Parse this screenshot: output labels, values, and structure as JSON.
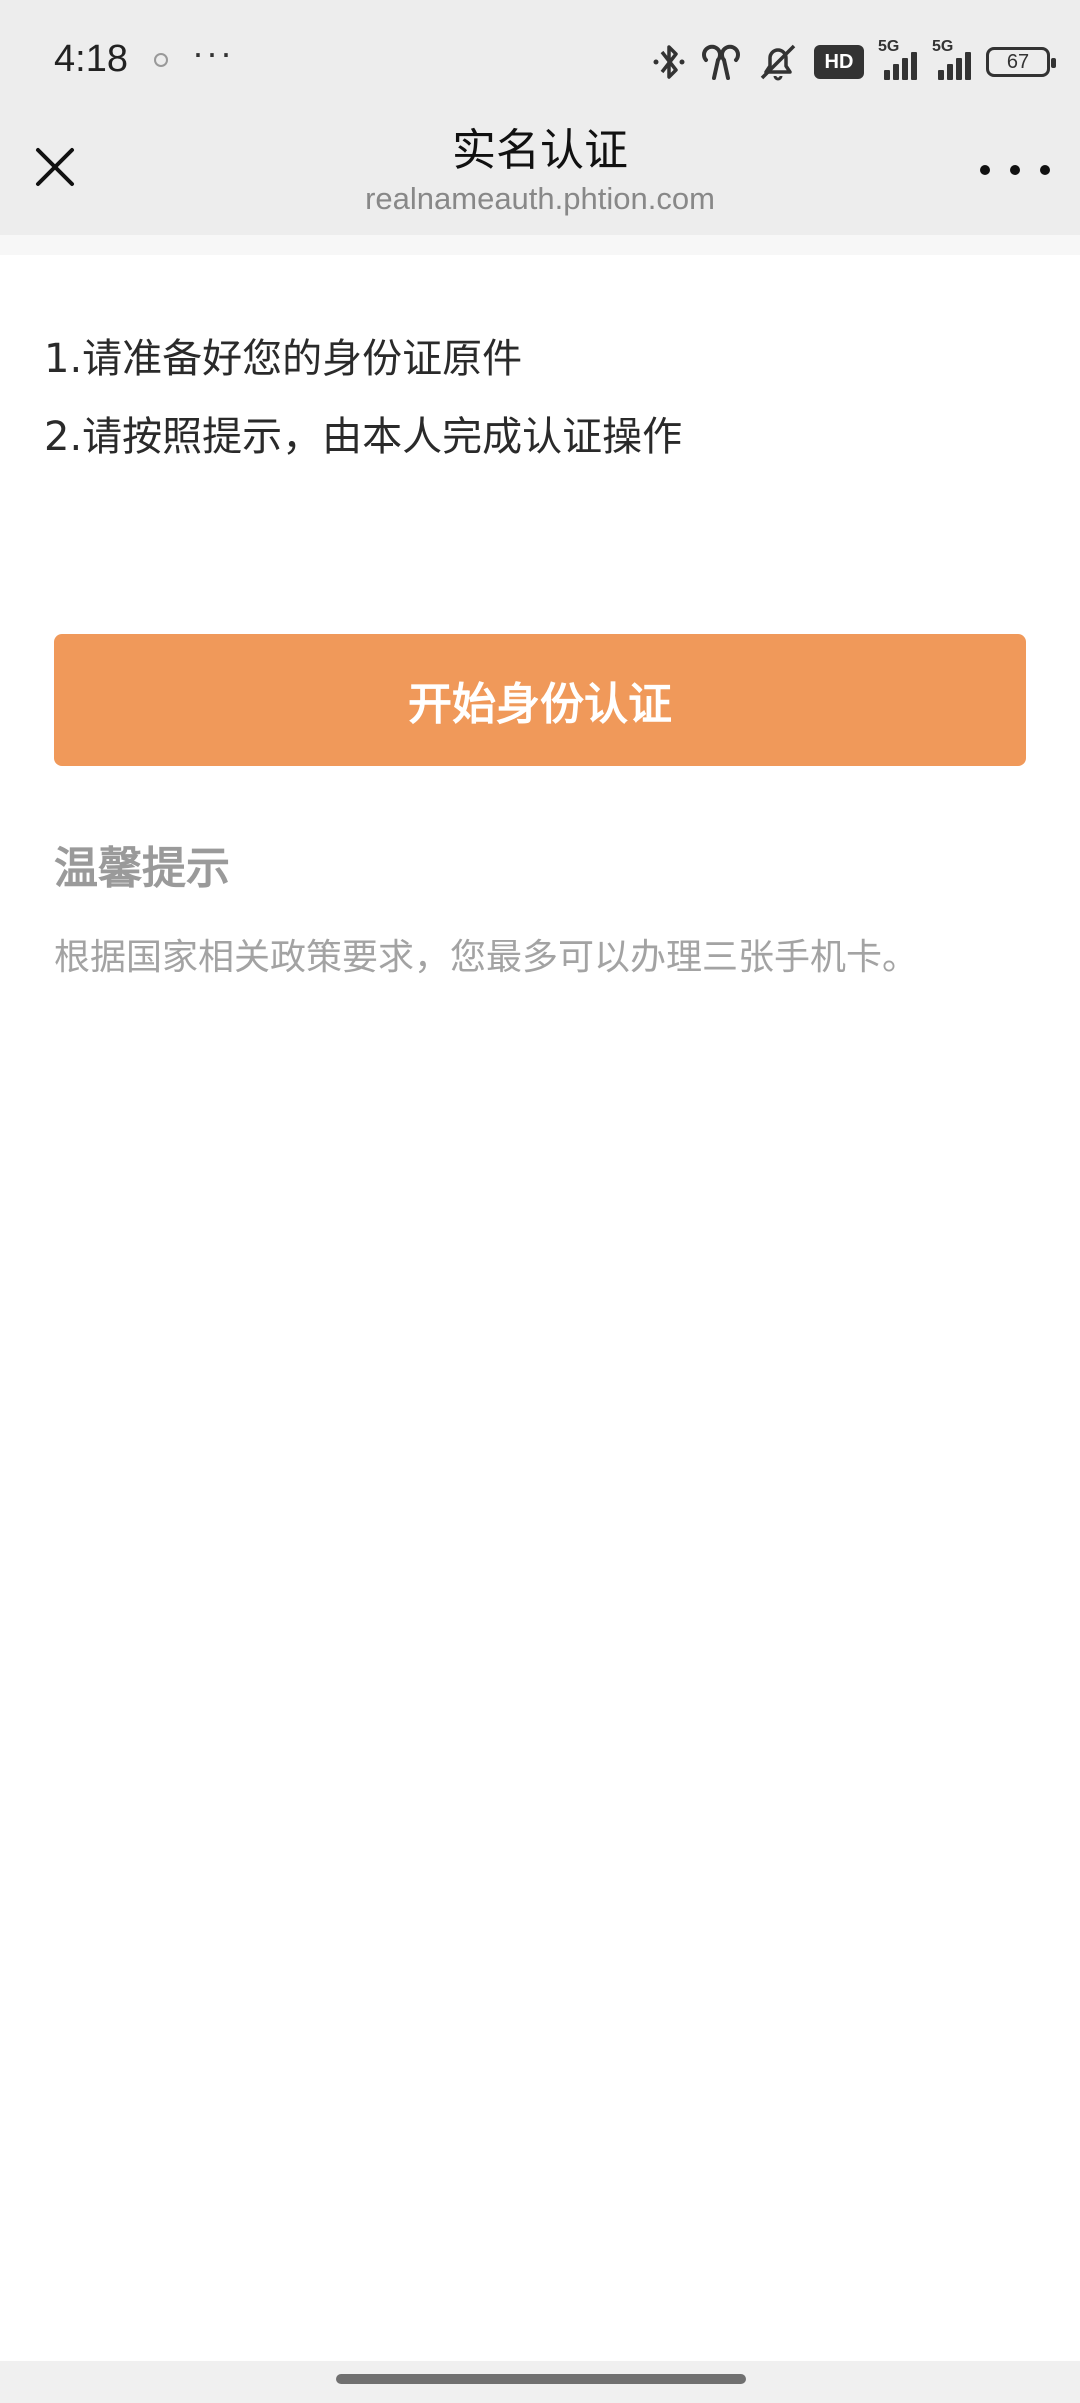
{
  "status_bar": {
    "time": "4:18",
    "more": "···",
    "hd_label": "HD",
    "signal_1_tag": "5G",
    "signal_2_tag": "5G",
    "battery": "67"
  },
  "nav": {
    "title": "实名认证",
    "url": "realnameauth.phtion.com"
  },
  "instructions": [
    "1.请准备好您的身份证原件",
    "2.请按照提示，由本人完成认证操作"
  ],
  "start_button_label": "开始身份认证",
  "tips": {
    "title": "温馨提示",
    "text": "根据国家相关政策要求，您最多可以办理三张手机卡。"
  },
  "colors": {
    "accent": "#f0995a",
    "header_bg": "#ededed"
  }
}
